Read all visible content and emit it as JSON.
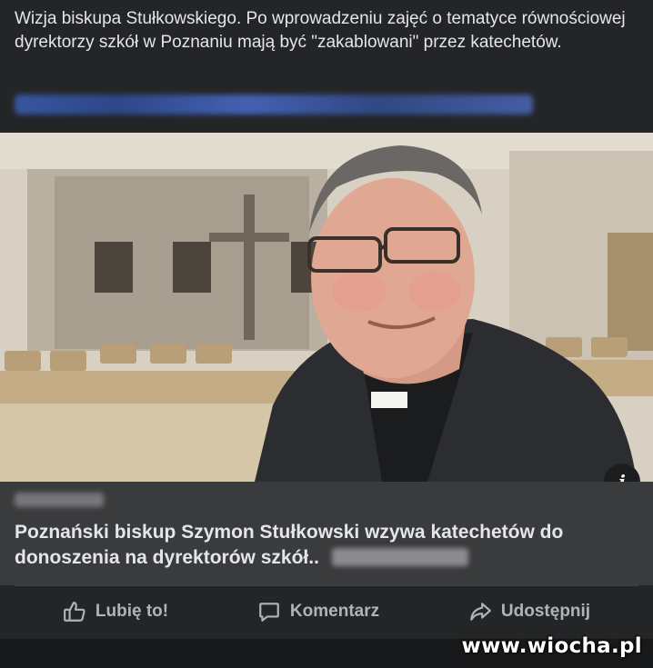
{
  "post": {
    "text": "Wizja biskupa Stułkowskiego. Po wprowadzeniu zajęć o tematyce równościowej dyrektorzy szkół w Poznaniu mają być \"zakablowani\" przez katechetów."
  },
  "link_card": {
    "headline": "Poznański biskup Szymon Stułkowski wzywa katechetów do donoszenia na dyrektorów szkół.."
  },
  "info_icon": "i",
  "actions": {
    "like_label": "Lubię to!",
    "comment_label": "Komentarz",
    "share_label": "Udostępnij"
  },
  "watermark": "www.wiocha.pl",
  "colors": {
    "background": "#242526",
    "card": "#3a3b3c",
    "text": "#e4e6eb",
    "muted": "#b0b3b8"
  }
}
